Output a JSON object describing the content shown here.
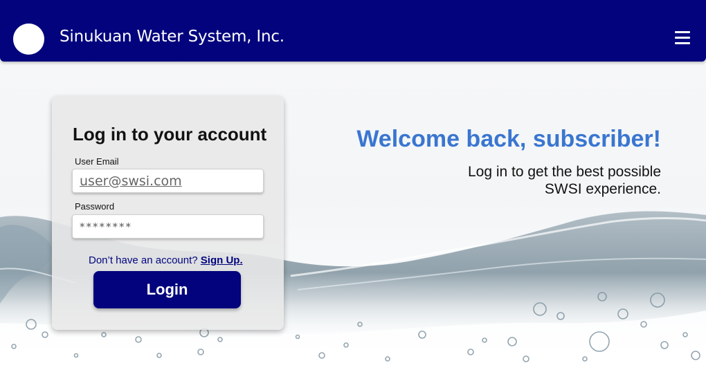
{
  "header": {
    "brand": "Sinukuan Water System, Inc.",
    "menu_icon": "hamburger-menu-icon",
    "background_color": "#02037d"
  },
  "login": {
    "title": "Log in to your account",
    "email_label": "User Email",
    "email_placeholder": "user@swsi.com",
    "password_label": "Password",
    "password_value": "********",
    "signup_prompt": "Don’t have an account?",
    "signup_link": "Sign Up.",
    "login_button": "Login"
  },
  "welcome": {
    "heading": "Welcome back, subscriber!",
    "subtext": "Log in to get the best possible SWSI experience.",
    "heading_color": "#3a76d0"
  }
}
